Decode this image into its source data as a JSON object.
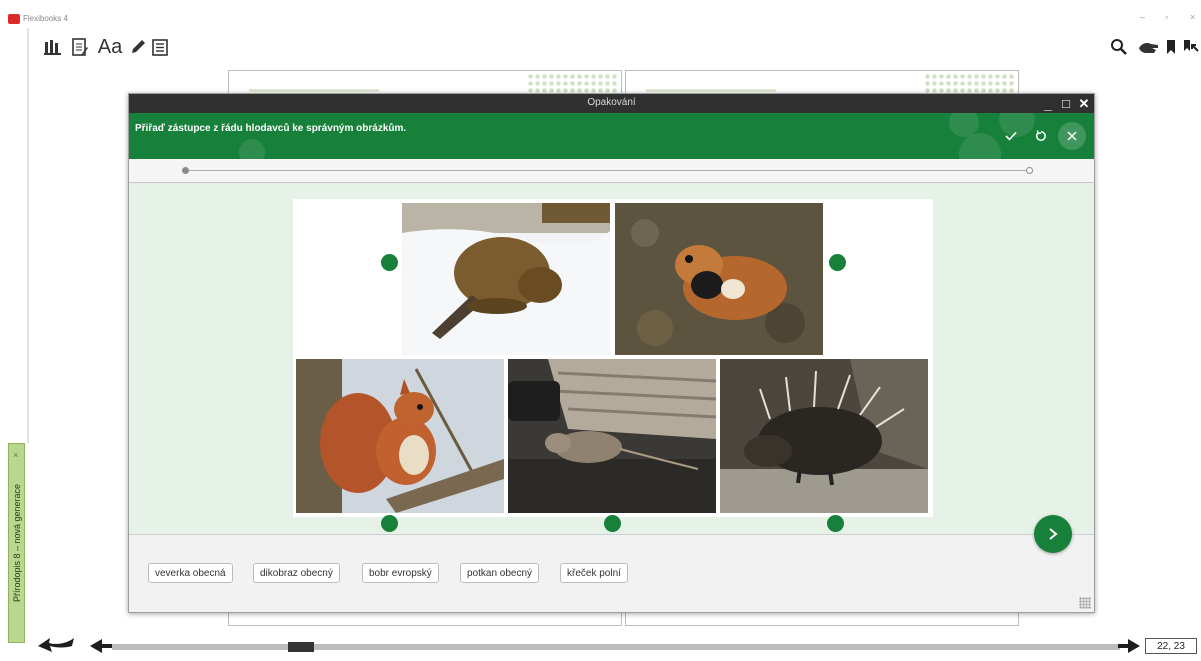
{
  "app": {
    "title": "Flexibooks 4",
    "window_controls": {
      "minimize": "–",
      "maximize": "▫",
      "close": "×"
    }
  },
  "toolbar_left": [
    {
      "name": "library-icon"
    },
    {
      "name": "notes-icon"
    },
    {
      "name": "font-size-button",
      "label": "Aa"
    },
    {
      "name": "pencil-icon"
    },
    {
      "name": "page-view-icon"
    }
  ],
  "toolbar_right": [
    {
      "name": "search-icon"
    },
    {
      "name": "hand-icon"
    },
    {
      "name": "bookmark-icon"
    },
    {
      "name": "bookmark-list-icon"
    }
  ],
  "side_tab": {
    "label": "Přírodopis 8 – nová generace",
    "close": "×"
  },
  "dialog": {
    "title": "Opakování",
    "instruction": "Přiřaď zástupce z řádu hlodavců ke správným obrázkům.",
    "controls": {
      "minimize": "_",
      "maximize": "□",
      "close": "✕"
    },
    "progress": {
      "current": 1,
      "total": 2
    },
    "answers": [
      "veverka obecná",
      "dikobraz obecný",
      "bobr evropský",
      "potkan obecný",
      "křeček polní"
    ],
    "images": [
      {
        "name": "beaver-photo"
      },
      {
        "name": "hamster-photo"
      },
      {
        "name": "squirrel-photo"
      },
      {
        "name": "rat-photo"
      },
      {
        "name": "porcupine-photo"
      }
    ]
  },
  "page_indicator": "22, 23",
  "colors": {
    "accent_green": "#17803a",
    "titlebar": "#303030",
    "dialog_bg": "#e6f2e7"
  }
}
